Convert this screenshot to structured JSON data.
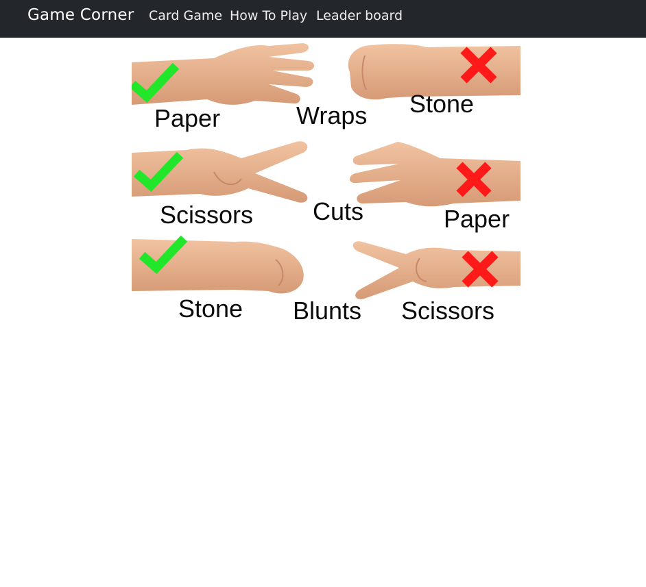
{
  "navbar": {
    "brand": "Game Corner",
    "links": [
      "Card Game",
      "How To Play",
      "Leader board"
    ],
    "background": "#23272b"
  },
  "rules_image": {
    "rows": [
      {
        "winner": "Paper",
        "verb": "Wraps",
        "loser": "Stone"
      },
      {
        "winner": "Scissors",
        "verb": "Cuts",
        "loser": "Paper"
      },
      {
        "winner": "Stone",
        "verb": "Blunts",
        "loser": "Scissors"
      }
    ],
    "winner_mark": "check-icon",
    "loser_mark": "cross-icon",
    "check_color": "#22e62a",
    "cross_color": "#ff1a1a",
    "skin_color": "#e8b48f"
  }
}
